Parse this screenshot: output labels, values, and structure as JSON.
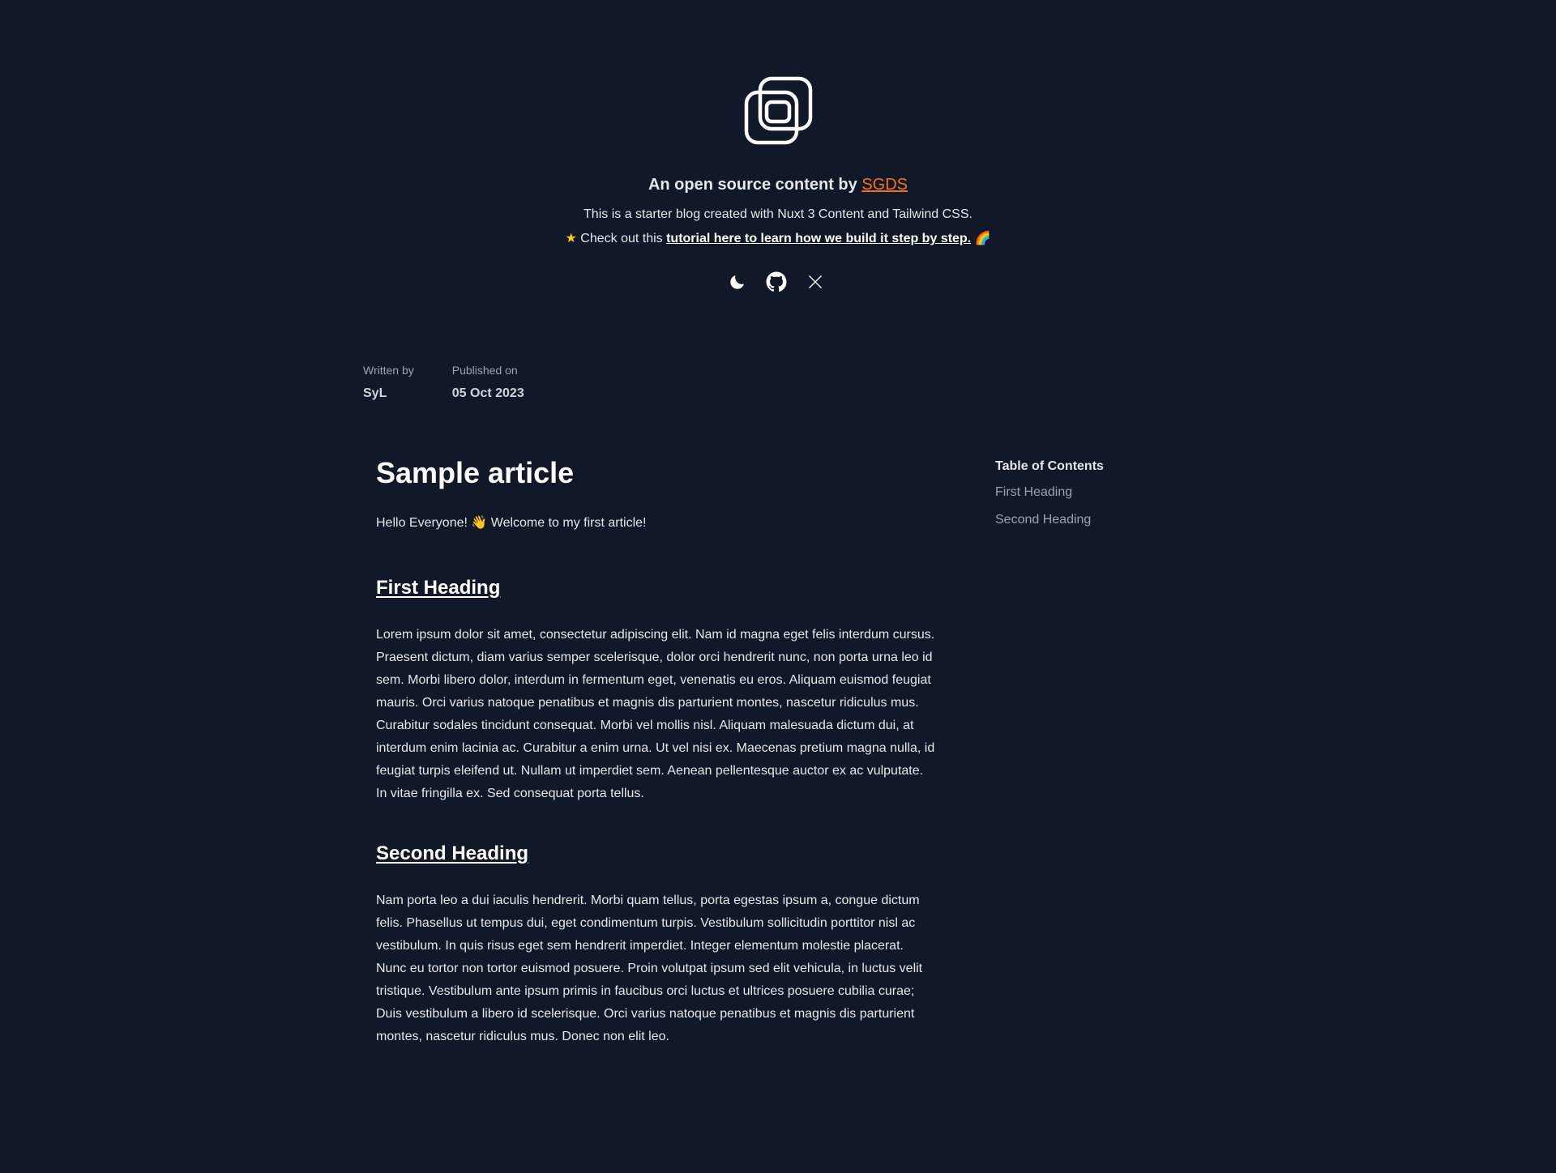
{
  "header": {
    "logo_icon": "logo-icon",
    "tagline_prefix": "An open source content by ",
    "tagline_link": "SGDS",
    "description": "This is a starter blog created with Nuxt 3 Content and Tailwind CSS.",
    "tutorial_star": "★",
    "tutorial_prefix": "Check out this ",
    "tutorial_link": "tutorial here to learn how we build it step by step.",
    "tutorial_suffix": " 🌈",
    "icons": [
      "moon-icon",
      "github-icon",
      "x-icon"
    ]
  },
  "meta": {
    "written_by_label": "Written by",
    "author": "SyL",
    "published_label": "Published on",
    "date": "05 Oct 2023"
  },
  "article": {
    "title": "Sample article",
    "intro": "Hello Everyone! 👋 Welcome to my first article!",
    "sections": [
      {
        "heading": "First Heading",
        "body": "Lorem ipsum dolor sit amet, consectetur adipiscing elit. Nam id magna eget felis interdum cursus. Praesent dictum, diam varius semper scelerisque, dolor orci hendrerit nunc, non porta urna leo id sem. Morbi libero dolor, interdum in fermentum eget, venenatis eu eros. Aliquam euismod feugiat mauris. Orci varius natoque penatibus et magnis dis parturient montes, nascetur ridiculus mus. Curabitur sodales tincidunt consequat. Morbi vel mollis nisl. Aliquam malesuada dictum dui, at interdum enim lacinia ac. Curabitur a enim urna. Ut vel nisi ex. Maecenas pretium magna nulla, id feugiat turpis eleifend ut. Nullam ut imperdiet sem. Aenean pellentesque auctor ex ac vulputate. In vitae fringilla ex. Sed consequat porta tellus."
      },
      {
        "heading": "Second Heading",
        "body": "Nam porta leo a dui iaculis hendrerit. Morbi quam tellus, porta egestas ipsum a, congue dictum felis. Phasellus ut tempus dui, eget condimentum turpis. Vestibulum sollicitudin porttitor nisl ac vestibulum. In quis risus eget sem hendrerit imperdiet. Integer elementum molestie placerat. Nunc eu tortor non tortor euismod posuere. Proin volutpat ipsum sed elit vehicula, in luctus velit tristique. Vestibulum ante ipsum primis in faucibus orci luctus et ultrices posuere cubilia curae; Duis vestibulum a libero id scelerisque. Orci varius natoque penatibus et magnis dis parturient montes, nascetur ridiculus mus. Donec non elit leo."
      }
    ]
  },
  "toc": {
    "title": "Table of Contents",
    "items": [
      "First Heading",
      "Second Heading"
    ]
  },
  "colors": {
    "background": "#111827",
    "accent": "#f97316",
    "text": "#e5e7eb",
    "muted": "#9ca3af"
  }
}
